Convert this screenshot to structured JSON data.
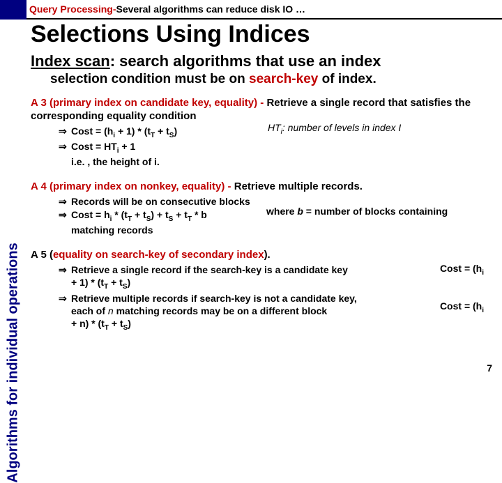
{
  "topbar": {
    "prefix": "Query Processing-",
    "rest": " Several algorithms can reduce disk IO …"
  },
  "sidebar": {
    "label": "Algorithms for individual operations"
  },
  "title": "Selections Using Indices",
  "subhead": {
    "under": "Index scan",
    "rest": ": search algorithms that use an index"
  },
  "subsub": {
    "a": "selection condition must be on ",
    "red": "search-key",
    "b": " of index."
  },
  "a3": {
    "head_red": "A 3 (primary index on candidate key, equality) - ",
    "head_rest": "Retrieve a single record that satisfies the corresponding equality condition",
    "b1": "Cost = (h",
    "b1_sub1": "i",
    "b1_mid": " + 1) * (t",
    "b1_sub2": "T",
    "b1_mid2": " + t",
    "b1_sub3": "S",
    "b1_end": ")",
    "b2a": "Cost = HT",
    "b2a_sub": "i",
    "b2a_end": " + 1",
    "b2b": "i.e. , the height of i.",
    "aside_a": "HT",
    "aside_sub": "i",
    "aside_b": ": number of levels in index I"
  },
  "a4": {
    "head_red": "A 4 (primary index on nonkey, equality) - ",
    "head_rest": "Retrieve multiple records.",
    "b1": "Records will be on consecutive blocks",
    "b2": "Cost = h",
    "b2_sub1": "i",
    "b2_mid": " * (t",
    "b2_sub2": "T",
    "b2_mid2": " + t",
    "b2_sub3": "S",
    "b2_mid3": ") + t",
    "b2_sub4": "S",
    "b2_mid4": " + t",
    "b2_sub5": "T",
    "b2_end": " * b",
    "aside_a": "where ",
    "aside_i": "b",
    "aside_b": " = number of blocks containing",
    "b3": "matching records"
  },
  "a5": {
    "head_a": "A 5 (",
    "head_red": "equality on search-key of secondary index",
    "head_b": ").",
    "b1a": "Retrieve a single record if the search-key is a candidate key",
    "b1b": "+ 1) * (t",
    "b1b_sub1": "T",
    "b1b_mid": " + t",
    "b1b_sub2": "S",
    "b1b_end": ")",
    "b2a": "Retrieve multiple records if search-key is not a candidate key,",
    "b2b_a": "each of ",
    "b2b_i": "n ",
    "b2b_b": "matching records may be on a different block",
    "b2c": "+ n) * (t",
    "b2c_sub1": "T",
    "b2c_mid": " + t",
    "b2c_sub2": "S",
    "b2c_end": ")",
    "cost1": "Cost =  (h",
    "cost1_sub": "i",
    "cost2": "Cost =  (h",
    "cost2_sub": "i"
  },
  "page": "7"
}
